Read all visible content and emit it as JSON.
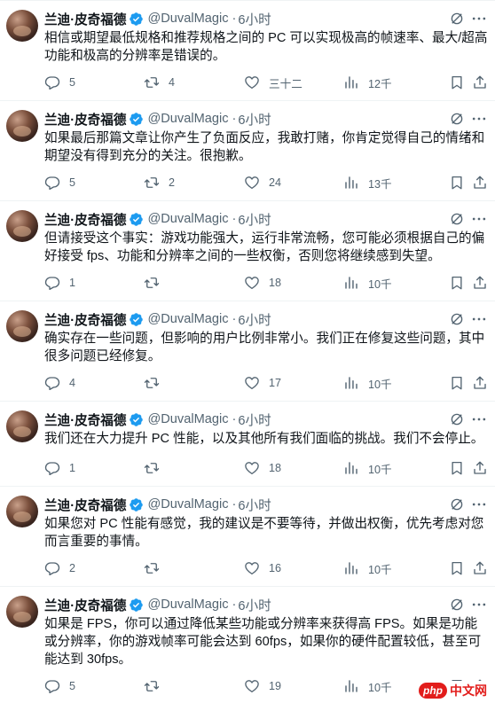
{
  "author": {
    "name": "兰迪·皮奇福德",
    "handle": "@DuvalMagic",
    "dot": "·"
  },
  "colors": {
    "verified": "#1d9bf0",
    "muted": "#536471",
    "text": "#0f1419"
  },
  "icons": [
    "verified-badge-icon",
    "grok-icon",
    "more-icon",
    "reply-icon",
    "retweet-icon",
    "like-icon",
    "views-icon",
    "bookmark-icon",
    "share-icon"
  ],
  "tweets": [
    {
      "time": "6小时",
      "text": "相信或期望最低规格和推荐规格之间的 PC 可以实现极高的帧速率、最大/超高功能和极高的分辨率是错误的。",
      "replies": "5",
      "retweets": "4",
      "likes": "三十二",
      "views": "12千"
    },
    {
      "time": "6小时",
      "text": "如果最后那篇文章让你产生了负面反应，我敢打赌，你肯定觉得自己的情绪和期望没有得到充分的关注。很抱歉。",
      "replies": "5",
      "retweets": "2",
      "likes": "24",
      "views": "13千"
    },
    {
      "time": "6小时",
      "text": "但请接受这个事实：游戏功能强大，运行非常流畅，您可能必须根据自己的偏好接受 fps、功能和分辨率之间的一些权衡，否则您将继续感到失望。",
      "replies": "1",
      "retweets": "",
      "likes": "18",
      "views": "10千"
    },
    {
      "time": "6小时",
      "text": "确实存在一些问题，但影响的用户比例非常小。我们正在修复这些问题，其中很多问题已经修复。",
      "replies": "4",
      "retweets": "",
      "likes": "17",
      "views": "10千"
    },
    {
      "time": "6小时",
      "text": "我们还在大力提升 PC 性能，以及其他所有我们面临的挑战。我们不会停止。",
      "replies": "1",
      "retweets": "",
      "likes": "18",
      "views": "10千"
    },
    {
      "time": "6小时",
      "text": "如果您对 PC 性能有感觉，我的建议是不要等待，并做出权衡，优先考虑对您而言重要的事情。",
      "replies": "2",
      "retweets": "",
      "likes": "16",
      "views": "10千"
    },
    {
      "time": "6小时",
      "text": "如果是 FPS，你可以通过降低某些功能或分辨率来获得高 FPS。如果是功能或分辨率，你的游戏帧率可能会达到 60fps，如果你的硬件配置较低，甚至可能达到 30fps。",
      "replies": "5",
      "retweets": "",
      "likes": "19",
      "views": "10千"
    }
  ],
  "watermark": {
    "php": "php",
    "cn": "中文网"
  }
}
